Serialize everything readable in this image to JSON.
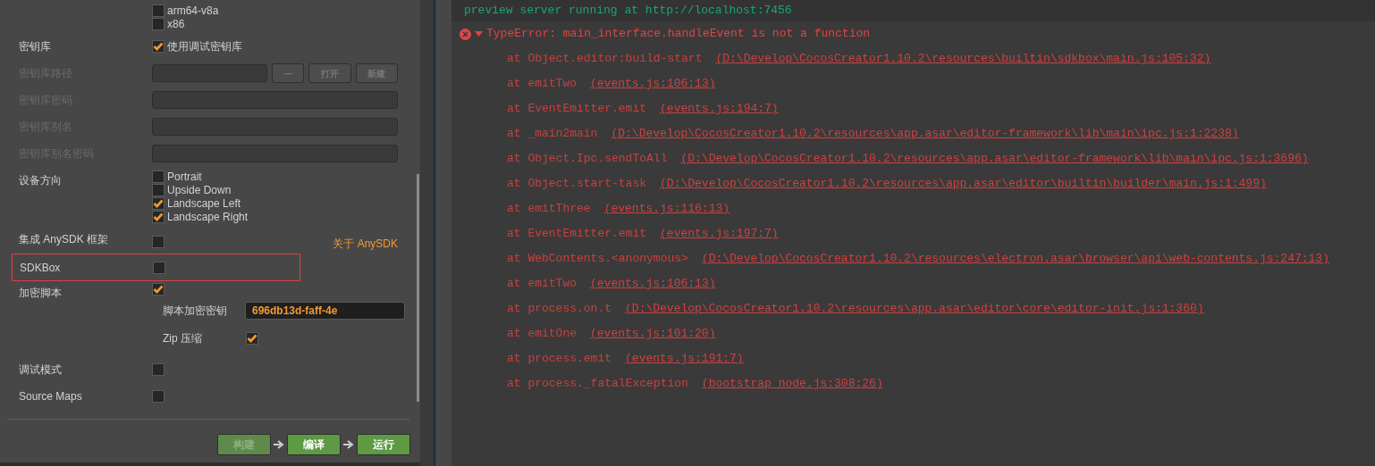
{
  "architectures": [
    {
      "label": "arm64-v8a",
      "checked": false
    },
    {
      "label": "x86",
      "checked": false
    }
  ],
  "keystore": {
    "label": "密钥库",
    "option": "使用调试密钥库",
    "checked": true
  },
  "keystore_fields": [
    {
      "label": "密钥库路径",
      "disabled": true,
      "buttons": [
        "—",
        "打开",
        "新建"
      ]
    },
    {
      "label": "密钥库密码",
      "disabled": true
    },
    {
      "label": "密钥库别名",
      "disabled": true
    },
    {
      "label": "密钥库别名密码",
      "disabled": true
    }
  ],
  "orientation": {
    "label": "设备方向",
    "options": [
      {
        "label": "Portrait",
        "checked": false
      },
      {
        "label": "Upside Down",
        "checked": false
      },
      {
        "label": "Landscape Left",
        "checked": true
      },
      {
        "label": "Landscape Right",
        "checked": true
      }
    ]
  },
  "anysdk": {
    "label": "集成 AnySDK 框架",
    "checked": false,
    "link": "关于 AnySDK"
  },
  "sdkbox": {
    "label": "SDKBox",
    "checked": false,
    "highlighted": true
  },
  "encrypt": {
    "label": "加密脚本",
    "checked": true,
    "key_label": "脚本加密密钥",
    "key_value": "696db13d-faff-4e",
    "zip_label": "Zip 压缩",
    "zip_checked": true
  },
  "debug": {
    "label": "调试模式",
    "checked": false
  },
  "source_maps": {
    "label": "Source Maps",
    "checked": false
  },
  "actions": [
    {
      "label": "构建",
      "disabled": true
    },
    {
      "label": "编译",
      "disabled": false
    },
    {
      "label": "运行",
      "disabled": false
    }
  ],
  "console": {
    "info": "preview server running at http://localhost:7456",
    "error": {
      "message": "TypeError: main_interface.handleEvent is not a function",
      "expanded": true,
      "stack": [
        {
          "frame": "at Object.editor:build-start",
          "location": "(D:\\Develop\\CocosCreator1.10.2\\resources\\builtin\\sdkbox\\main.js:105:32)"
        },
        {
          "frame": "at emitTwo",
          "location": "(events.js:106:13)"
        },
        {
          "frame": "at EventEmitter.emit",
          "location": "(events.js:194:7)"
        },
        {
          "frame": "at _main2main",
          "location": "(D:\\Develop\\CocosCreator1.10.2\\resources\\app.asar\\editor-framework\\lib\\main\\ipc.js:1:2238)"
        },
        {
          "frame": "at Object.Ipc.sendToAll",
          "location": "(D:\\Develop\\CocosCreator1.10.2\\resources\\app.asar\\editor-framework\\lib\\main\\ipc.js:1:3696)"
        },
        {
          "frame": "at Object.start-task",
          "location": "(D:\\Develop\\CocosCreator1.10.2\\resources\\app.asar\\editor\\builtin\\builder\\main.js:1:499)"
        },
        {
          "frame": "at emitThree",
          "location": "(events.js:116:13)"
        },
        {
          "frame": "at EventEmitter.emit",
          "location": "(events.js:197:7)"
        },
        {
          "frame": "at WebContents.<anonymous>",
          "location": "(D:\\Develop\\CocosCreator1.10.2\\resources\\electron.asar\\browser\\api\\web-contents.js:247:13)"
        },
        {
          "frame": "at emitTwo",
          "location": "(events.js:106:13)"
        },
        {
          "frame": "at process.on.t",
          "location": "(D:\\Develop\\CocosCreator1.10.2\\resources\\app.asar\\editor\\core\\editor-init.js:1:360)"
        },
        {
          "frame": "at emitOne",
          "location": "(events.js:101:20)"
        },
        {
          "frame": "at process.emit",
          "location": "(events.js:191:7)"
        },
        {
          "frame": "at process._fatalException",
          "location": "(bootstrap_node.js:308:26)"
        }
      ]
    }
  }
}
